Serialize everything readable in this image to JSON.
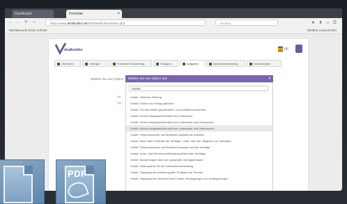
{
  "browser": {
    "tabs": [
      {
        "label": "Dashboard"
      },
      {
        "label": "Formular"
      }
    ],
    "address": {
      "prefix": "https://www.",
      "domain": "dealbuilder.net",
      "rest": "/start/verification/index.php"
    },
    "search_placeholder": "Suchen",
    "bookmarks_left": "Meistbesucht   Erste Schritte",
    "bookmarks_right": "Weitere Lesezeichen"
  },
  "app": {
    "logo_text": "dealbuilder",
    "language": "DE",
    "nav": [
      {
        "label": "Übersicht"
      },
      {
        "label": "Verträge"
      },
      {
        "label": "Formular Generierung"
      },
      {
        "label": "Vorlagen"
      },
      {
        "label": "Aufgaben"
      },
      {
        "label": "Benutzerverwaltung"
      },
      {
        "label": "Einstellungen"
      }
    ],
    "form": {
      "label": "Wählen Sie eine Option",
      "selected": "Wählen Sie eine Option aus",
      "filter_value": "Vorteil",
      "side_labels": [
        "Art:",
        "Typ:"
      ],
      "options": [
        "Vorteil: Jährliche Zahlung",
        "Vorteil: Kosten und Ertrag optimiert",
        "Vorteil: Für den Mieter geschrieben, zum profitieren bestimmt",
        "Vorteil: Höhere Ausgabesicherheit fuer Lieferanten",
        "Vorteil: Höhere Ausgabesicherheit fuer Lieferanten und Verbraucher",
        "Vorteil: Höhere Ausgabesicherheit fuer Lieferanten und Verbraucher",
        "Vorteil: Fehlerreduzierte und flexiblere Auswahl der Anbieter",
        "Vorteil: Nicht mehr Kontrolle der Verträge - Auftr. oder Abr. Abgleich von Verträgen",
        "Vorteil: Fehlerreduzierte und flexiblere Auswahl und alle Verträge",
        "Vorteil: Unter- und Überverschlüsselung bestimmter Verträge",
        "Vorteil: Auswertungen über den gesamten Vertragsbestand",
        "Vorteil: Zeitersparnis bei der Lieferantenverwaltung",
        "Vorteil: Transparente Verlinkung aller Projekte und Termine",
        "Vorteil: Transparente Übersicht über Fristen, Kündigungen und Verlängerungen"
      ]
    }
  },
  "file_icons": [
    {
      "label": "",
      "icon": "document-icon"
    },
    {
      "label": "PDF",
      "icon": "pdf-icon"
    }
  ]
}
